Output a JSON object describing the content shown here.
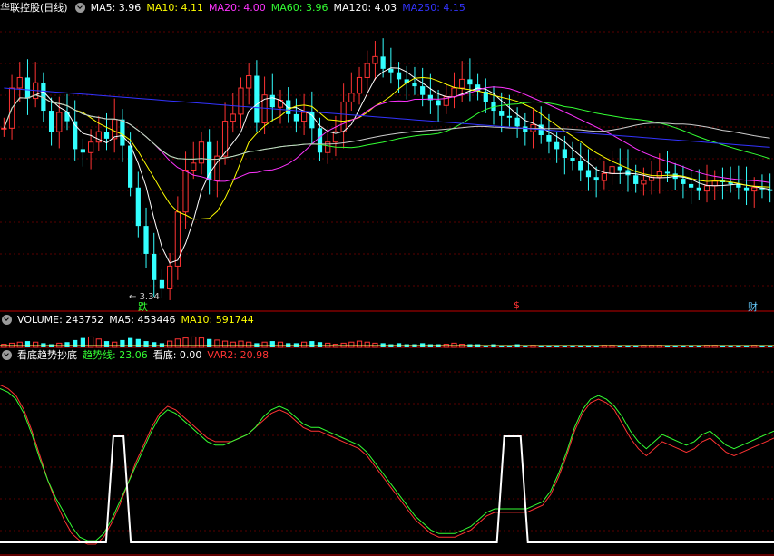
{
  "main": {
    "title": "华联控股(日线)",
    "ma": [
      {
        "label": "MA5: 3.96",
        "color": "#ffffff"
      },
      {
        "label": "MA10: 4.11",
        "color": "#ffff00"
      },
      {
        "label": "MA20: 4.00",
        "color": "#ff33ff"
      },
      {
        "label": "MA60: 3.96",
        "color": "#33ff33"
      },
      {
        "label": "MA120: 4.03",
        "color": "#ffffff"
      },
      {
        "label": "MA250: 4.15",
        "color": "#3333ff"
      }
    ],
    "low_label": "3.34",
    "markers": [
      {
        "text": "跌",
        "color": "#33ff33"
      },
      {
        "text": "$",
        "color": "#ff3333"
      },
      {
        "text": "财",
        "color": "#66ccff"
      }
    ]
  },
  "volume": {
    "title": "VOLUME: 243752",
    "ma5": "MA5: 453446",
    "ma10": "MA10: 591744"
  },
  "indicator": {
    "name": "看底趋势抄底",
    "trend": "趋势线: 23.06",
    "bottom": "看底: 0.00",
    "var2": "VAR2: 20.98"
  },
  "chart_data": {
    "type": "candlestick",
    "price_range": [
      3.34,
      4.95
    ],
    "up_color": "#ff3333",
    "down_color": "#33ffff",
    "closes": [
      4.32,
      4.55,
      4.61,
      4.49,
      4.58,
      4.42,
      4.3,
      4.41,
      4.36,
      4.2,
      4.18,
      4.24,
      4.3,
      4.26,
      4.37,
      4.22,
      3.98,
      3.76,
      3.6,
      3.45,
      3.4,
      3.53,
      3.84,
      4.08,
      4.12,
      4.24,
      4.02,
      4.16,
      4.36,
      4.4,
      4.55,
      4.62,
      4.35,
      4.51,
      4.44,
      4.48,
      4.4,
      4.36,
      4.41,
      4.32,
      4.18,
      4.24,
      4.3,
      4.47,
      4.52,
      4.61,
      4.69,
      4.73,
      4.66,
      4.64,
      4.6,
      4.58,
      4.56,
      4.51,
      4.48,
      4.45,
      4.5,
      4.55,
      4.6,
      4.57,
      4.53,
      4.47,
      4.42,
      4.39,
      4.38,
      4.33,
      4.3,
      4.34,
      4.28,
      4.24,
      4.2,
      4.15,
      4.13,
      4.08,
      4.04,
      4.02,
      4.06,
      4.1,
      4.08,
      4.05,
      4.0,
      4.02,
      4.04,
      4.07,
      4.06,
      4.03,
      4.0,
      3.98,
      3.96,
      3.99,
      4.02,
      4.01,
      4.0,
      3.98,
      3.96,
      3.98,
      3.97,
      3.96
    ],
    "volume_pct": [
      0.3,
      0.4,
      0.5,
      0.6,
      0.5,
      0.4,
      0.3,
      0.4,
      0.5,
      0.7,
      0.9,
      1.0,
      0.8,
      0.6,
      0.5,
      0.7,
      0.9,
      0.8,
      0.6,
      0.5,
      0.4,
      0.6,
      0.8,
      0.9,
      1.0,
      0.9,
      0.8,
      0.7,
      0.6,
      0.5,
      0.6,
      0.5,
      0.4,
      0.5,
      0.6,
      0.5,
      0.4,
      0.4,
      0.5,
      0.6,
      0.5,
      0.4,
      0.3,
      0.4,
      0.5,
      0.6,
      0.5,
      0.4,
      0.4,
      0.3,
      0.4,
      0.3,
      0.3,
      0.4,
      0.3,
      0.3,
      0.3,
      0.4,
      0.3,
      0.3,
      0.3,
      0.2,
      0.3,
      0.2,
      0.2,
      0.3,
      0.2,
      0.2,
      0.2,
      0.2,
      0.2,
      0.2,
      0.2,
      0.2,
      0.2,
      0.2,
      0.2,
      0.2,
      0.2,
      0.2,
      0.2,
      0.2,
      0.2,
      0.2,
      0.2,
      0.2,
      0.2,
      0.2,
      0.2,
      0.2,
      0.2,
      0.2,
      0.2,
      0.2,
      0.2,
      0.2,
      0.2,
      0.2
    ],
    "indicator_range": [
      0,
      100
    ],
    "trend_line": [
      88,
      86,
      82,
      74,
      62,
      48,
      36,
      26,
      18,
      10,
      4,
      2,
      2,
      6,
      14,
      24,
      34,
      44,
      54,
      64,
      72,
      76,
      74,
      70,
      66,
      62,
      58,
      56,
      56,
      58,
      60,
      62,
      66,
      72,
      76,
      78,
      76,
      72,
      68,
      66,
      66,
      64,
      62,
      60,
      58,
      56,
      52,
      46,
      40,
      34,
      28,
      22,
      16,
      12,
      8,
      6,
      6,
      6,
      8,
      10,
      14,
      18,
      20,
      20,
      20,
      20,
      20,
      22,
      24,
      30,
      40,
      52,
      66,
      76,
      82,
      84,
      82,
      78,
      72,
      64,
      58,
      54,
      58,
      62,
      60,
      58,
      56,
      58,
      62,
      64,
      60,
      56,
      54,
      56,
      58,
      60,
      62,
      64
    ],
    "var2_line": [
      90,
      88,
      84,
      76,
      64,
      50,
      36,
      24,
      14,
      6,
      2,
      0,
      0,
      4,
      12,
      22,
      34,
      46,
      56,
      66,
      74,
      78,
      76,
      72,
      68,
      64,
      60,
      58,
      58,
      58,
      60,
      62,
      66,
      70,
      74,
      76,
      74,
      70,
      66,
      64,
      64,
      62,
      60,
      58,
      56,
      54,
      50,
      44,
      38,
      32,
      26,
      20,
      14,
      10,
      6,
      4,
      4,
      4,
      6,
      8,
      12,
      16,
      18,
      18,
      18,
      18,
      18,
      20,
      22,
      28,
      38,
      50,
      64,
      74,
      80,
      82,
      80,
      76,
      68,
      60,
      54,
      50,
      54,
      58,
      56,
      54,
      52,
      54,
      58,
      60,
      56,
      52,
      50,
      52,
      54,
      56,
      58,
      60
    ],
    "bottom_signal_windows": [
      [
        0.137,
        0.169
      ],
      [
        0.642,
        0.682
      ]
    ]
  }
}
